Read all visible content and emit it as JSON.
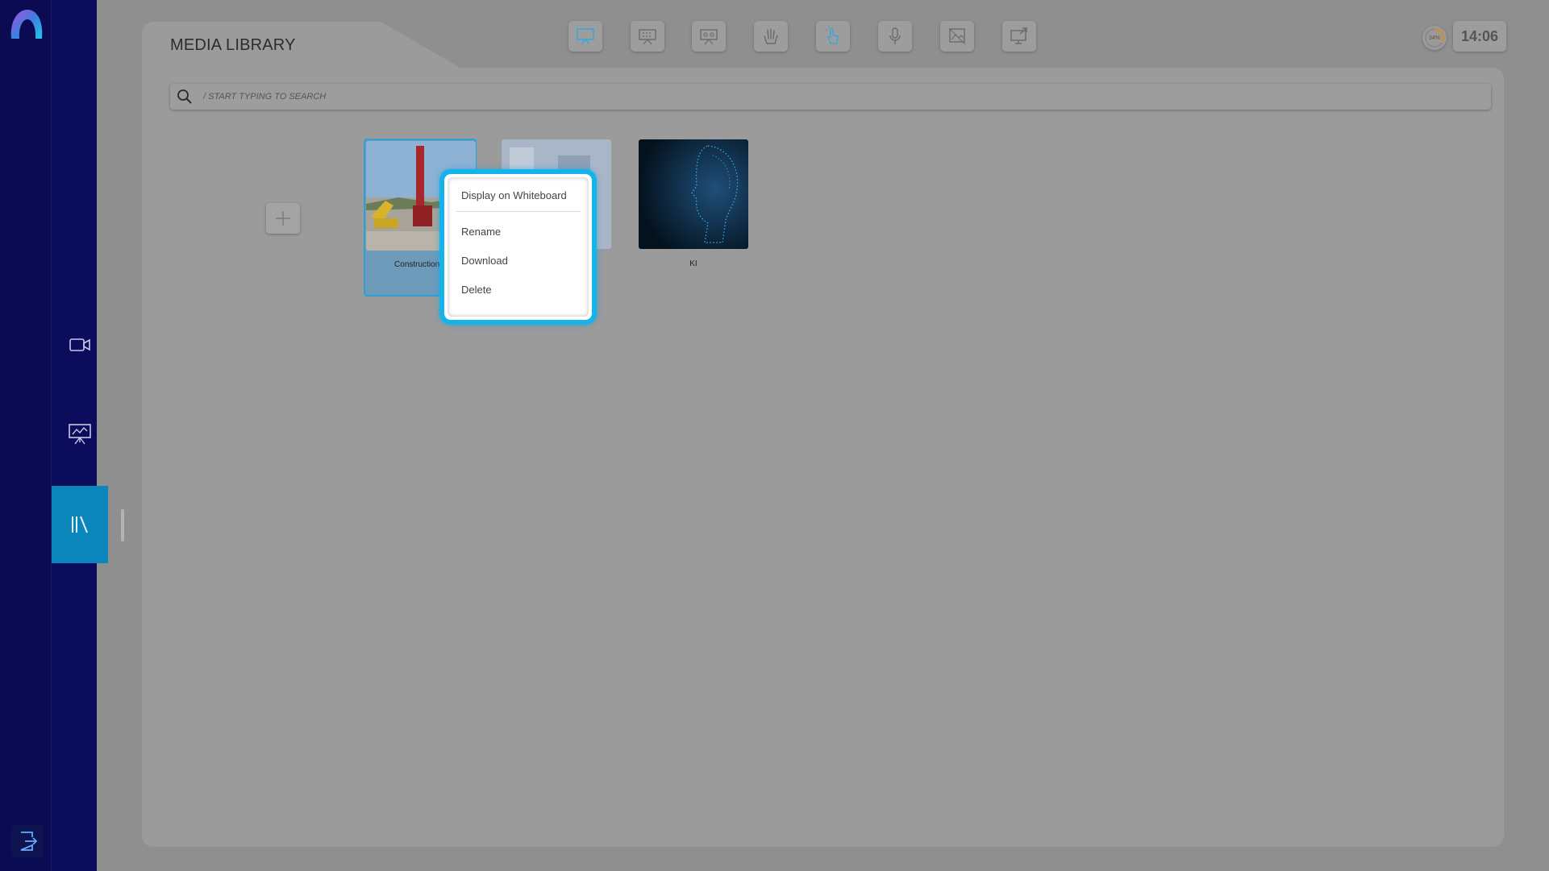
{
  "app": {
    "page_title": "MEDIA LIBRARY",
    "clock": "14:06",
    "gauge_label": "34%"
  },
  "sidebar": {
    "items": [
      {
        "name": "video-camera-icon",
        "active": false
      },
      {
        "name": "presentation-icon",
        "active": false
      },
      {
        "name": "library-icon",
        "active": true
      }
    ]
  },
  "toolbar": {
    "buttons": [
      "presentation-screen-icon",
      "grid-board-icon",
      "multi-screen-icon",
      "hand-raise-icon",
      "touch-pointer-icon",
      "microphone-icon",
      "image-frame-icon",
      "screen-share-icon"
    ]
  },
  "search": {
    "placeholder": "/ START TYPING TO SEARCH",
    "value": ""
  },
  "media": {
    "items": [
      {
        "label": "Construction s",
        "selected": true
      },
      {
        "label": "",
        "selected": false
      },
      {
        "label": "KI",
        "selected": false
      }
    ]
  },
  "context_menu": {
    "display_on_whiteboard": "Display on Whiteboard",
    "rename": "Rename",
    "download": "Download",
    "delete": "Delete"
  },
  "colors": {
    "rail_dark": "#0a0b52",
    "rail_accent": "#0a86bd",
    "menu_ring": "#14b3ec",
    "overlay_gray": "#9b9b9b"
  }
}
